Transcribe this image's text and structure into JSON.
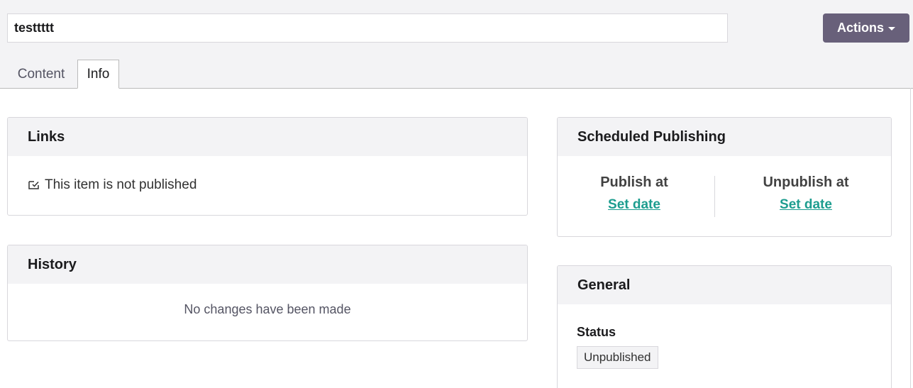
{
  "header": {
    "name_value": "testtttt",
    "actions_label": "Actions",
    "actions_icon": "caret-down-icon",
    "actions_color": "#68607a"
  },
  "tabs": [
    {
      "label": "Content",
      "active": false
    },
    {
      "label": "Info",
      "active": true
    }
  ],
  "links": {
    "title": "Links",
    "status_icon": "unpublished-icon",
    "status_text": "This item is not published"
  },
  "history": {
    "title": "History",
    "empty_text": "No changes have been made"
  },
  "scheduled": {
    "title": "Scheduled Publishing",
    "publish_label": "Publish at",
    "publish_link": "Set date",
    "unpublish_label": "Unpublish at",
    "unpublish_link": "Set date",
    "link_color": "#1d9d8f"
  },
  "general": {
    "title": "General",
    "status_label": "Status",
    "status_value": "Unpublished"
  }
}
